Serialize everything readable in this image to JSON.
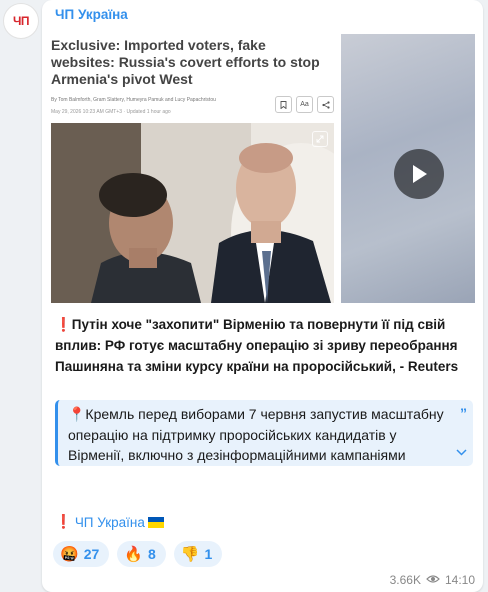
{
  "channel": {
    "avatar_text": "ЧП",
    "name": "ЧП Україна"
  },
  "media": {
    "article": {
      "title": "Exclusive: Imported voters, fake websites: Russia's covert efforts to stop Armenia's pivot West",
      "byline": "By Tom Balmforth, Gram Slattery, Humeyra Pamuk and Lucy Papachristou",
      "date": "May 29, 2026 10:23 AM GMT+3 · Updated 1 hour ago",
      "font_size_label": "Aa"
    },
    "video": {
      "play_icon": "play-icon"
    }
  },
  "post": {
    "text": "❗️Путін хоче \"захопити\" Вірменію та повернути її під свій вплив: РФ готує масштабну операцію зі зриву переобрання Пашиняна та зміни курсу країни на проросійський, - Reuters",
    "quote": "📍Кремль перед виборами 7 червня запустив масштабну операцію на підтримку проросійських кандидатів у Вірменії, включно з дезінформаційними кампаніями",
    "signature_prefix": "❗️",
    "signature_link": "ЧП Україна"
  },
  "reactions": [
    {
      "emoji": "🤬",
      "count": "27"
    },
    {
      "emoji": "🔥",
      "count": "8"
    },
    {
      "emoji": "👎",
      "count": "1"
    }
  ],
  "meta": {
    "views": "3.66K",
    "time": "14:10"
  },
  "colors": {
    "accent": "#3390ec",
    "avatar_red": "#d8262c",
    "flag_blue": "#0057b7",
    "flag_yellow": "#ffd700"
  }
}
